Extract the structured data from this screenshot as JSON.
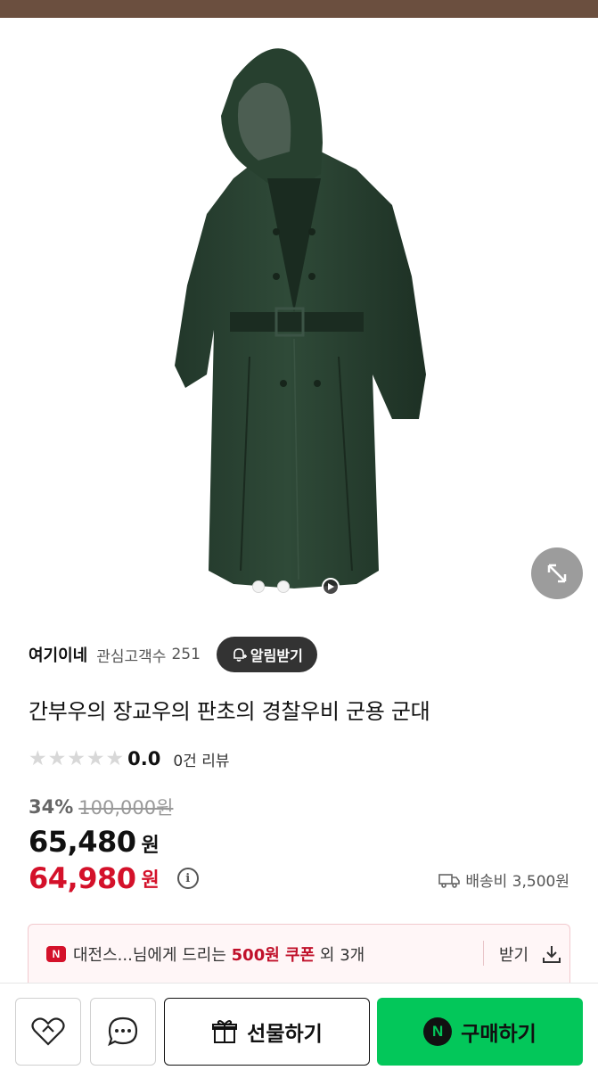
{
  "store": {
    "name": "여기이네",
    "interest_label": "관심고객수",
    "interest_count": "251",
    "alarm_label": "알림받기"
  },
  "product": {
    "title": "간부우의 장교우의 판초의 경찰우비 군용 군대",
    "image_icon": "raincoat-photo"
  },
  "rating": {
    "score": "0.0",
    "review_label": "0건 리뷰",
    "stars_filled": 0,
    "stars_total": 5
  },
  "price": {
    "discount_rate": "34%",
    "original_price": "100,000원",
    "sale_price": "65,480",
    "currency": "원",
    "coupon_price": "64,980",
    "coupon_currency": "원",
    "shipping_label": "배송비 3,500원"
  },
  "coupon": {
    "badge": "N",
    "text_prefix": "대전스...님에게 드리는 ",
    "text_highlight": "500원 쿠폰",
    "text_suffix": " 외 3개",
    "receive_label": "받기"
  },
  "carousel": {
    "dot_count": 2,
    "has_video": true
  },
  "bottom_bar": {
    "gift_label": "선물하기",
    "buy_label": "구매하기",
    "npay_badge": "N"
  },
  "colors": {
    "accent_red": "#d4112a",
    "naver_green": "#03c75a",
    "top_bar": "#6b4f3f"
  }
}
